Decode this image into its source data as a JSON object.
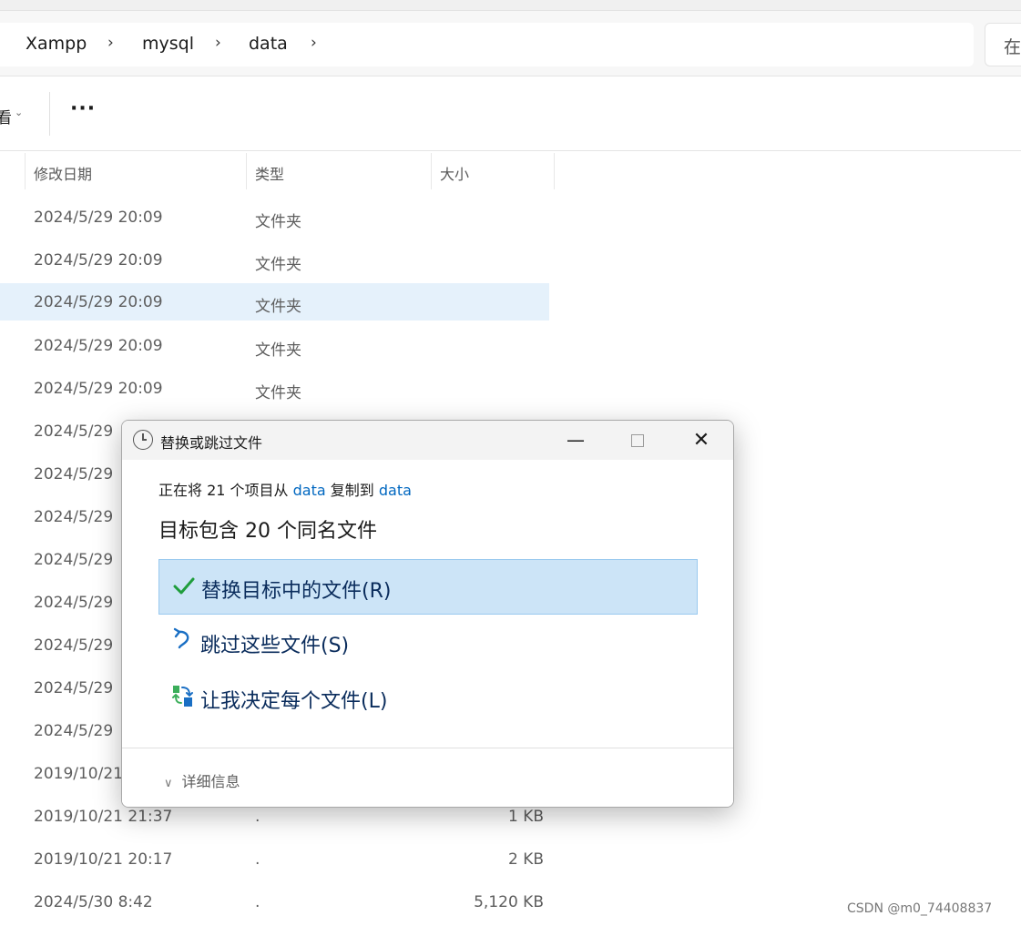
{
  "breadcrumb": {
    "items": [
      "Xampp",
      "mysql",
      "data"
    ],
    "separator": "›"
  },
  "search": {
    "placeholder": "在"
  },
  "toolbar": {
    "view_label": "看",
    "view_chevron": "⌄",
    "more_label": "···"
  },
  "columns": {
    "date": "修改日期",
    "type": "类型",
    "size": "大小"
  },
  "rows": [
    {
      "date": "2024/5/29 20:09",
      "type": "文件夹",
      "size": ""
    },
    {
      "date": "2024/5/29 20:09",
      "type": "文件夹",
      "size": ""
    },
    {
      "date": "2024/5/29 20:09",
      "type": "文件夹",
      "size": "",
      "selected": true
    },
    {
      "date": "2024/5/29 20:09",
      "type": "文件夹",
      "size": ""
    },
    {
      "date": "2024/5/29 20:09",
      "type": "文件夹",
      "size": ""
    },
    {
      "date": "2024/5/29",
      "type": "",
      "size": ""
    },
    {
      "date": "2024/5/29",
      "type": "",
      "size": ""
    },
    {
      "date": "2024/5/29",
      "type": "",
      "size": ""
    },
    {
      "date": "2024/5/29",
      "type": "",
      "size": ""
    },
    {
      "date": "2024/5/29",
      "type": "",
      "size": ""
    },
    {
      "date": "2024/5/29",
      "type": "",
      "size": ""
    },
    {
      "date": "2024/5/29",
      "type": "",
      "size": ""
    },
    {
      "date": "2024/5/29",
      "type": "",
      "size": ""
    },
    {
      "date": "2019/10/21",
      "type": "",
      "size": ""
    },
    {
      "date": "2019/10/21 21:37",
      "type": ".",
      "size": "1 KB"
    },
    {
      "date": "2019/10/21 20:17",
      "type": ".",
      "size": "2 KB"
    },
    {
      "date": "2024/5/30 8:42",
      "type": ".",
      "size": "5,120 KB"
    }
  ],
  "dialog": {
    "title": "替换或跳过文件",
    "minimize": "—",
    "close": "✕",
    "copy_prefix": "正在将 21 个项目从 ",
    "copy_source": "data",
    "copy_middle": " 复制到 ",
    "copy_target": "data",
    "headline": "目标包含 20 个同名文件",
    "options": [
      {
        "label": "替换目标中的文件(R)"
      },
      {
        "label": "跳过这些文件(S)"
      },
      {
        "label": "让我决定每个文件(L)"
      }
    ],
    "details_label": "详细信息"
  },
  "watermark": "CSDN @m0_74408837",
  "colors": {
    "accent": "#0067c0",
    "selection": "#e5f1fb",
    "option_highlight": "#cce4f7",
    "check": "#1f9d3c"
  }
}
